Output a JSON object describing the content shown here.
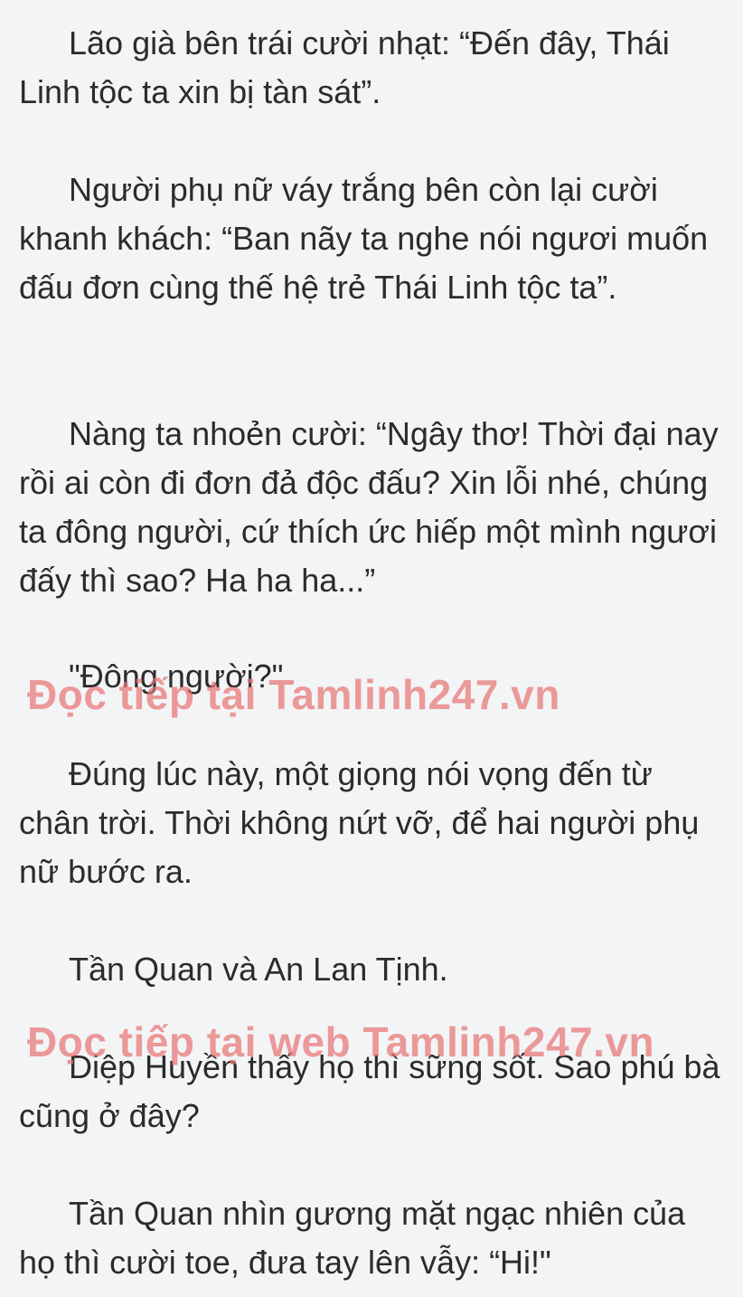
{
  "paragraphs": [
    "Lão già bên trái cười nhạt: “Đến đây, Thái Linh tộc ta xin bị tàn sát”.",
    "Người phụ nữ váy trắng bên còn lại cười khanh khách: “Ban nãy ta nghe nói ngươi muốn đấu đơn cùng thế hệ trẻ Thái Linh tộc ta”.",
    "Nàng ta nhoẻn cười: “Ngây thơ! Thời đại nay rồi ai còn đi đơn đả độc đấu? Xin lỗi nhé, chúng ta đông người, cứ thích ức hiếp một mình ngươi đấy thì sao? Ha ha ha...”",
    "\"Đông người?\"",
    "Đúng lúc này, một giọng nói vọng đến từ chân trời. Thời không nứt vỡ, để hai người phụ nữ bước ra.",
    "Tần Quan và An Lan Tịnh.",
    "Diệp Huyền thấy họ thì sững sốt. Sao phú bà cũng ở đây?",
    "Tần Quan nhìn gương mặt ngạc nhiên của họ thì cười toe, đưa tay lên vẫy: “Hi!\""
  ],
  "watermarks": [
    "Đọc tiếp tại Tamlinh247.vn",
    "Đọc tiếp tại web Tamlinh247.vn"
  ],
  "colors": {
    "background": "#f3f4f6",
    "text": "#2b2b2b",
    "watermark": "#e87474"
  }
}
